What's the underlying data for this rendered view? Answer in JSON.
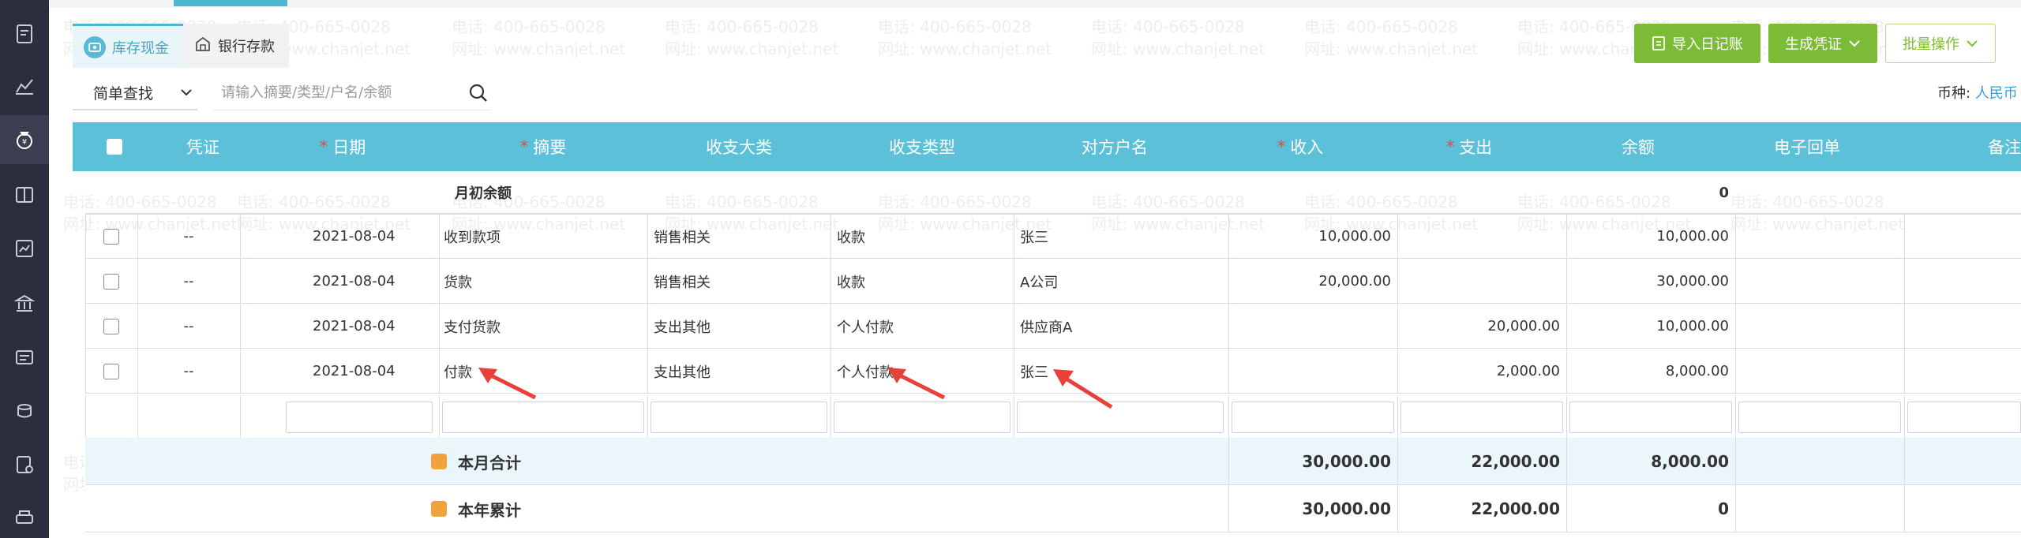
{
  "sidebar": {
    "icons": [
      "document-icon",
      "chart-line-icon",
      "money-bag-icon",
      "ledger-icon",
      "report-icon",
      "bank-icon",
      "invoice-icon",
      "coins-icon",
      "voucher-icon",
      "printer-icon"
    ]
  },
  "tabs": [
    {
      "label": "库存现金",
      "icon": "cash-icon"
    },
    {
      "label": "银行存款",
      "icon": "bank-icon"
    }
  ],
  "search": {
    "mode": "简单查找",
    "placeholder": "请输入摘要/类型/户名/余额"
  },
  "actions": {
    "import": "导入日记账",
    "generate": "生成凭证",
    "batch": "批量操作"
  },
  "currency": {
    "label": "币种:",
    "value": "人民币"
  },
  "table": {
    "headers": {
      "voucher": "凭证",
      "date": "日期",
      "summary": "摘要",
      "category": "收支大类",
      "type": "收支类型",
      "account": "对方户名",
      "income": "收入",
      "expense": "支出",
      "balance": "余额",
      "receipt": "电子回单",
      "note": "备注"
    },
    "opening": {
      "label": "月初余额",
      "balance": "0"
    },
    "rows": [
      {
        "voucher": "--",
        "date": "2021-08-04",
        "summary": "收到款项",
        "category": "销售相关",
        "type": "收款",
        "account": "张三",
        "income": "10,000.00",
        "expense": "",
        "balance": "10,000.00"
      },
      {
        "voucher": "--",
        "date": "2021-08-04",
        "summary": "货款",
        "category": "销售相关",
        "type": "收款",
        "account": "A公司",
        "income": "20,000.00",
        "expense": "",
        "balance": "30,000.00"
      },
      {
        "voucher": "--",
        "date": "2021-08-04",
        "summary": "支付货款",
        "category": "支出其他",
        "type": "个人付款",
        "account": "供应商A",
        "income": "",
        "expense": "20,000.00",
        "balance": "10,000.00"
      },
      {
        "voucher": "--",
        "date": "2021-08-04",
        "summary": "付款",
        "category": "支出其他",
        "type": "个人付款",
        "account": "张三",
        "income": "",
        "expense": "2,000.00",
        "balance": "8,000.00"
      }
    ],
    "month_total": {
      "label": "本月合计",
      "income": "30,000.00",
      "expense": "22,000.00",
      "balance": "8,000.00"
    },
    "year_total": {
      "label": "本年累计",
      "income": "30,000.00",
      "expense": "22,000.00",
      "balance": "0"
    }
  },
  "watermark": {
    "phone": "电话: 400-665-0028",
    "site": "网址: www.chanjet.net"
  },
  "colors": {
    "accent": "#5bc0d8",
    "green": "#7cbb35",
    "arrow": "#e8413a"
  }
}
